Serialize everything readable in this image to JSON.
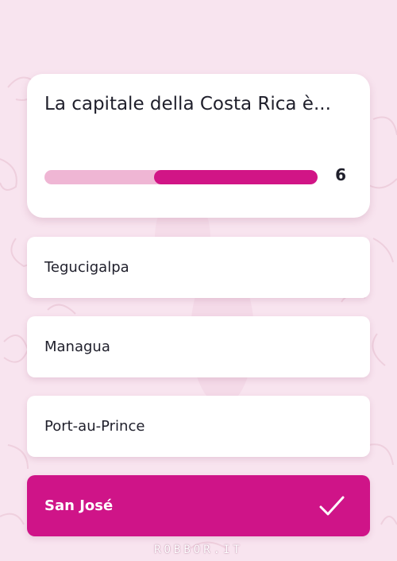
{
  "question": {
    "text": "La capitale della Costa Rica è...",
    "progress_fraction": 0.6,
    "counter": "6"
  },
  "answers": [
    {
      "label": "Tegucigalpa"
    },
    {
      "label": "Managua"
    },
    {
      "label": "Port-au-Prince"
    },
    {
      "label": "San José",
      "state": "correct"
    }
  ],
  "watermark": "ROBBOR.IT",
  "colors": {
    "accent": "#cf1488",
    "progress_track": "#efb6d4",
    "background": "#f8e4ef"
  }
}
